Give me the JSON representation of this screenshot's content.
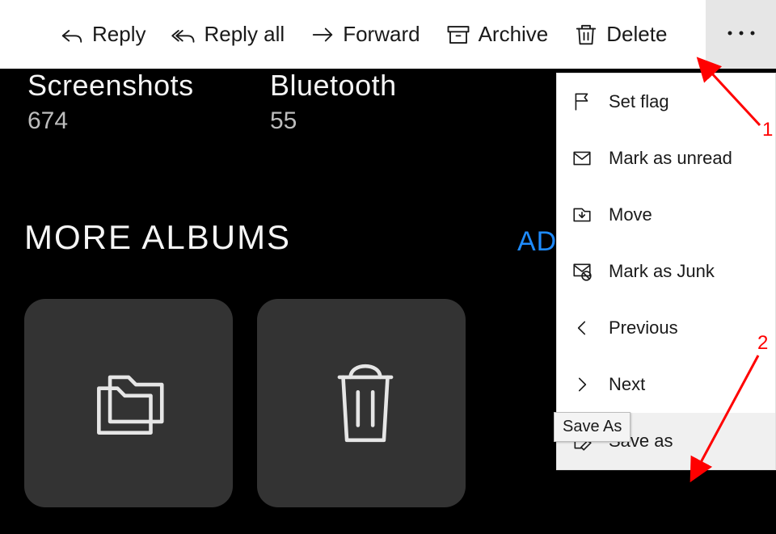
{
  "toolbar": {
    "reply": "Reply",
    "reply_all": "Reply all",
    "forward": "Forward",
    "archive": "Archive",
    "delete": "Delete"
  },
  "menu": {
    "set_flag": "Set flag",
    "mark_unread": "Mark as unread",
    "move": "Move",
    "mark_junk": "Mark as Junk",
    "previous": "Previous",
    "next": "Next",
    "save_as": "Save as",
    "save_as_tooltip": "Save As"
  },
  "gallery": {
    "folder1_name": "Screenshots",
    "folder1_count": "674",
    "folder2_name": "Bluetooth",
    "folder2_count": "55",
    "section_title": "MORE ALBUMS",
    "add_partial": "AD"
  },
  "annotations": {
    "label1": "1",
    "label2": "2"
  }
}
